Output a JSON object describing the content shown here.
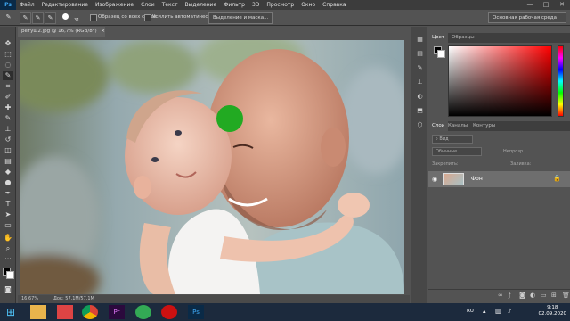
{
  "app": {
    "logo": "Ps"
  },
  "menu": [
    "Файл",
    "Редактирование",
    "Изображение",
    "Слои",
    "Текст",
    "Выделение",
    "Фильтр",
    "3D",
    "Просмотр",
    "Окно",
    "Справка"
  ],
  "window_controls": {
    "minimize": "—",
    "maximize": "□",
    "close": "✕"
  },
  "options": {
    "size_value": "31",
    "sample_all_layers": "Образец со всех слоев",
    "auto_enhance": "Усилить автоматически",
    "select_and_mask": "Выделение и маска...",
    "workspace": "Основная рабочая среда"
  },
  "document": {
    "tab_title": "ретуш2.jpg @ 16,7% (RGB/8*)",
    "close": "×",
    "zoom": "16,67%",
    "doc_size": "Док: 57,1М/57,1М",
    "brush_color": "#22aa22"
  },
  "color_panel": {
    "tabs": [
      "Цвет",
      "Образцы"
    ],
    "foreground": "#000000",
    "background": "#ffffff"
  },
  "layers_panel": {
    "tabs": [
      "Слои",
      "Каналы",
      "Контуры"
    ],
    "search_placeholder": "Вид",
    "blend_mode": "Обычные",
    "opacity_label": "Непрозр.:",
    "lock_label": "Закрепить:",
    "fill_label": "Заливка:",
    "layer_name": "Фон"
  },
  "taskbar": {
    "lang": "RU",
    "time": "9:18",
    "date": "02.09.2020"
  }
}
